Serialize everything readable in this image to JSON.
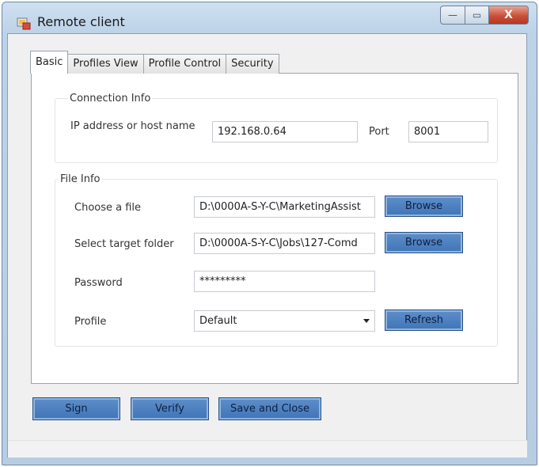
{
  "window": {
    "title": "Remote client",
    "controls": {
      "minimize": "—",
      "maximize": "▭",
      "close": "X"
    }
  },
  "tabs": [
    {
      "label": "Basic",
      "active": true
    },
    {
      "label": "Profiles View",
      "active": false
    },
    {
      "label": "Profile Control",
      "active": false
    },
    {
      "label": "Security",
      "active": false
    }
  ],
  "connection": {
    "group_title": "Connection Info",
    "host_label": "IP address or host name",
    "host_value": "192.168.0.64",
    "port_label": "Port",
    "port_value": "8001"
  },
  "file": {
    "group_title": "File Info",
    "choose_label": "Choose a file",
    "choose_value": "D:\\0000A-S-Y-C\\MarketingAssist",
    "browse1_label": "Browse",
    "target_label": "Select target folder",
    "target_value": "D:\\0000A-S-Y-C\\Jobs\\127-Comd",
    "browse2_label": "Browse",
    "password_label": "Password",
    "password_value": "*********",
    "profile_label": "Profile",
    "profile_value": "Default",
    "refresh_label": "Refresh"
  },
  "actions": {
    "sign": "Sign",
    "verify": "Verify",
    "save_close": "Save and Close"
  },
  "colors": {
    "button_accent": "#4a7fc0",
    "close_button": "#c9503a"
  },
  "icons": {
    "app": "remote-client-app-icon"
  }
}
